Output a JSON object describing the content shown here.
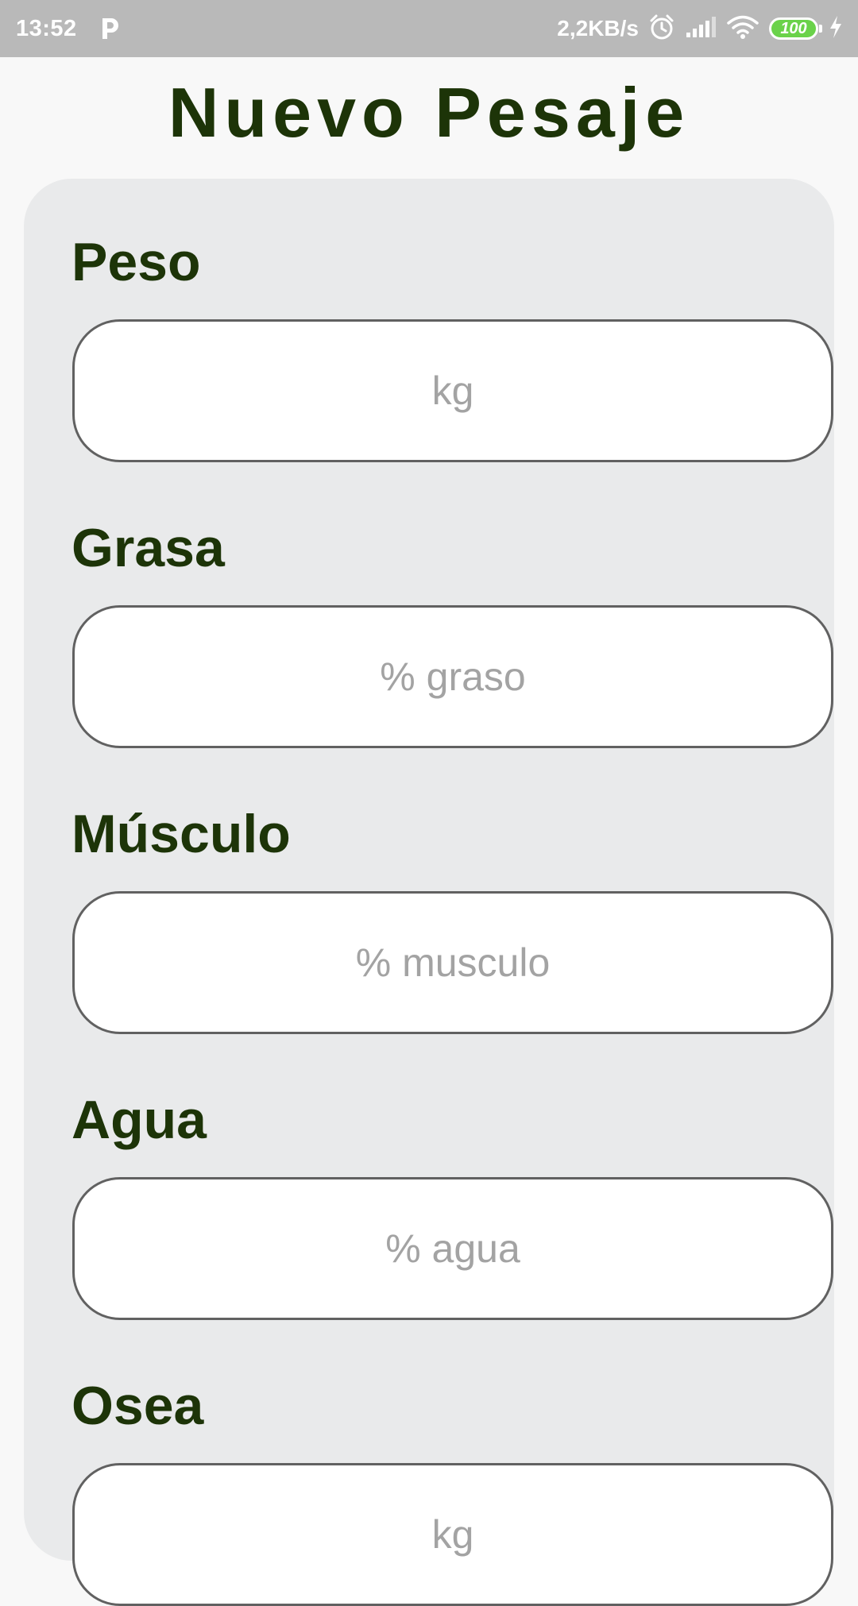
{
  "status_bar": {
    "time": "13:52",
    "app_icon": "p-letter-icon",
    "net_speed": "2,2KB/s",
    "icons": [
      "alarm-icon",
      "signal-icon",
      "wifi-icon",
      "charging-icon"
    ],
    "battery": "100",
    "battery_color": "#6ad24a"
  },
  "page": {
    "title": "Nuevo Pesaje",
    "title_color": "#1d3408"
  },
  "form": {
    "fields": [
      {
        "label": "Peso",
        "placeholder": "kg",
        "value": ""
      },
      {
        "label": "Grasa",
        "placeholder": "% graso",
        "value": ""
      },
      {
        "label": "Músculo",
        "placeholder": "% musculo",
        "value": ""
      },
      {
        "label": "Agua",
        "placeholder": "% agua",
        "value": ""
      },
      {
        "label": "Osea",
        "placeholder": "kg",
        "value": ""
      }
    ]
  }
}
